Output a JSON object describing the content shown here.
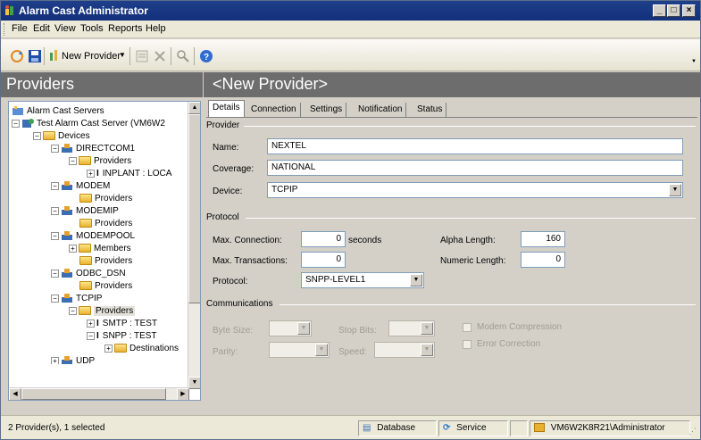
{
  "window": {
    "title": "Alarm Cast Administrator"
  },
  "menu": [
    "File",
    "Edit",
    "View",
    "Tools",
    "Reports",
    "Help"
  ],
  "toolbar": {
    "new_provider_label": "New Provider"
  },
  "left_pane": {
    "title": "Providers",
    "tree": [
      {
        "label": "Alarm Cast Servers"
      },
      {
        "label": "Test Alarm Cast Server (VM6W2"
      },
      {
        "label": "Devices"
      },
      {
        "label": "DIRECTCOM1"
      },
      {
        "label": "Providers"
      },
      {
        "label": "INPLANT : LOCA"
      },
      {
        "label": "MODEM"
      },
      {
        "label": "Providers"
      },
      {
        "label": "MODEMIP"
      },
      {
        "label": "Providers"
      },
      {
        "label": "MODEMPOOL"
      },
      {
        "label": "Members"
      },
      {
        "label": "Providers"
      },
      {
        "label": "ODBC_DSN"
      },
      {
        "label": "Providers"
      },
      {
        "label": "TCPIP"
      },
      {
        "label": "Providers"
      },
      {
        "label": "SMTP : TEST"
      },
      {
        "label": "SNPP : TEST"
      },
      {
        "label": "Destinations"
      },
      {
        "label": "UDP"
      }
    ]
  },
  "right_pane": {
    "title": "<New Provider>",
    "tabs": [
      "Details",
      "Connection",
      "Settings",
      "Notification",
      "Status"
    ],
    "provider_group": "Provider",
    "name_label": "Name:",
    "name_value": "NEXTEL",
    "coverage_label": "Coverage:",
    "coverage_value": "NATIONAL",
    "device_label": "Device:",
    "device_value": "TCPIP",
    "protocol_group": "Protocol",
    "max_connection_label": "Max. Connection:",
    "max_connection_value": "0",
    "seconds_label": "seconds",
    "alpha_length_label": "Alpha Length:",
    "alpha_length_value": "160",
    "max_transactions_label": "Max. Transactions:",
    "max_transactions_value": "0",
    "numeric_length_label": "Numeric Length:",
    "numeric_length_value": "0",
    "protocol_label": "Protocol:",
    "protocol_value": "SNPP-LEVEL1",
    "communications_group": "Communications",
    "byte_size_label": "Byte Size:",
    "stop_bits_label": "Stop Bits:",
    "modem_compression_label": "Modem Compression",
    "parity_label": "Parity:",
    "speed_label": "Speed:",
    "error_correction_label": "Error Correction"
  },
  "status_bar": {
    "selection": "2 Provider(s), 1 selected",
    "database": "Database",
    "service": "Service",
    "user": "VM6W2K8R21\\Administrator"
  }
}
